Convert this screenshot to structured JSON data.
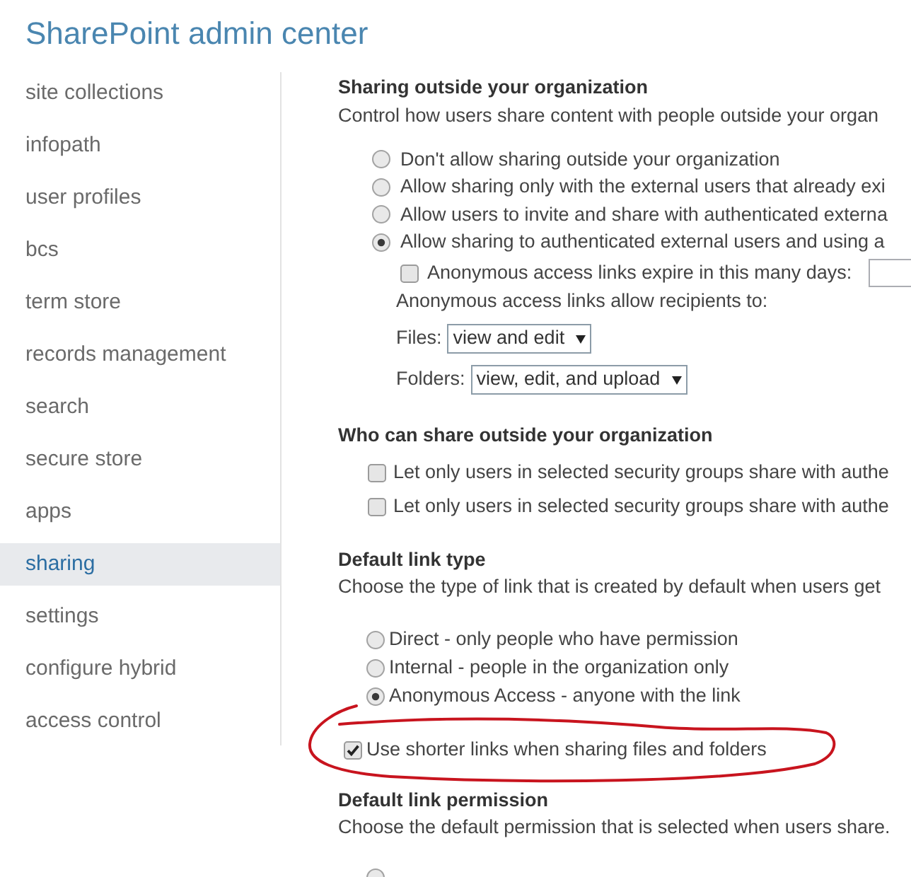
{
  "header": {
    "title": "SharePoint admin center"
  },
  "sidebar": {
    "items": [
      {
        "label": "site collections",
        "selected": false
      },
      {
        "label": "infopath",
        "selected": false
      },
      {
        "label": "user profiles",
        "selected": false
      },
      {
        "label": "bcs",
        "selected": false
      },
      {
        "label": "term store",
        "selected": false
      },
      {
        "label": "records management",
        "selected": false
      },
      {
        "label": "search",
        "selected": false
      },
      {
        "label": "secure store",
        "selected": false
      },
      {
        "label": "apps",
        "selected": false
      },
      {
        "label": "sharing",
        "selected": true
      },
      {
        "label": "settings",
        "selected": false
      },
      {
        "label": "configure hybrid",
        "selected": false
      },
      {
        "label": "access control",
        "selected": false
      }
    ]
  },
  "sharing_outside": {
    "heading": "Sharing outside your organization",
    "description": "Control how users share content with people outside your organ",
    "options": [
      {
        "label": "Don't allow sharing outside your organization",
        "selected": false
      },
      {
        "label": "Allow sharing only with the external users that already exi",
        "selected": false
      },
      {
        "label": "Allow users to invite and share with authenticated externa",
        "selected": false
      },
      {
        "label": "Allow sharing to authenticated external users and using a",
        "selected": true
      }
    ],
    "anonymous_settings": {
      "expire": {
        "label": "Anonymous access links expire in this many days:",
        "checked": false
      },
      "recipients_label": "Anonymous access links allow recipients to:",
      "dropdowns": [
        {
          "label": "Files:",
          "value": "view and edit"
        },
        {
          "label": "Folders:",
          "value": "view, edit, and upload"
        }
      ]
    }
  },
  "who_can_share": {
    "heading": "Who can share outside your organization",
    "options": [
      {
        "label": "Let only users in selected security groups share with authe",
        "checked": false
      },
      {
        "label": "Let only users in selected security groups share with authe",
        "checked": false
      }
    ]
  },
  "default_link_type": {
    "heading": "Default link type",
    "description": "Choose the type of link that is created by default when users get",
    "options": [
      {
        "label": "Direct - only people who have permission",
        "selected": false
      },
      {
        "label": "Internal - people in the organization only",
        "selected": false
      },
      {
        "label": "Anonymous Access - anyone with the link",
        "selected": true
      }
    ],
    "shorter_links": {
      "label": "Use shorter links when sharing files and folders",
      "checked": true
    }
  },
  "default_link_permission": {
    "heading": "Default link permission",
    "description": "Choose the default permission that is selected when users share.",
    "options": [
      {
        "selected": false
      }
    ]
  }
}
